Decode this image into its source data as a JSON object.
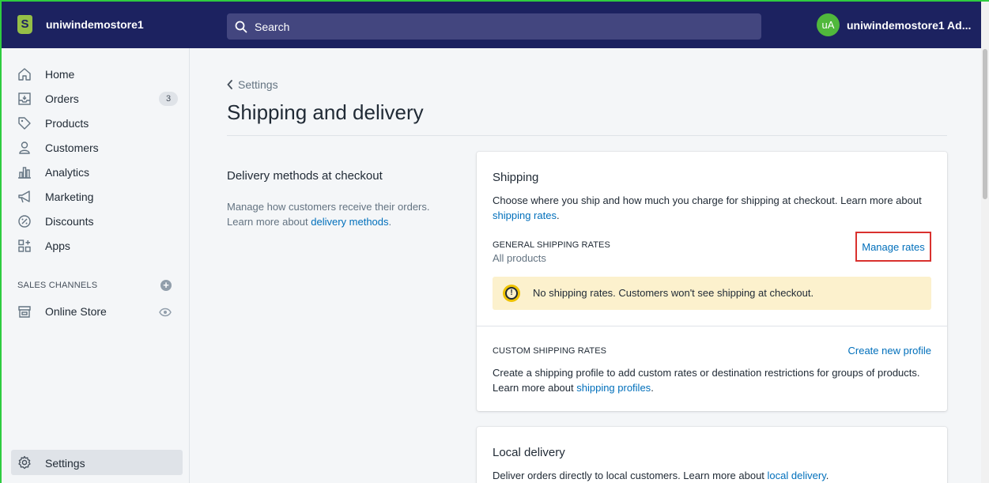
{
  "topbar": {
    "store_name": "uniwindemostore1",
    "logo_letter": "S",
    "search_placeholder": "Search",
    "avatar_initials": "uA",
    "account_name": "uniwindemostore1 Ad..."
  },
  "sidebar": {
    "items": [
      {
        "label": "Home",
        "icon": "home-icon"
      },
      {
        "label": "Orders",
        "icon": "orders-icon",
        "badge": "3"
      },
      {
        "label": "Products",
        "icon": "tag-icon"
      },
      {
        "label": "Customers",
        "icon": "person-icon"
      },
      {
        "label": "Analytics",
        "icon": "bar-chart-icon"
      },
      {
        "label": "Marketing",
        "icon": "megaphone-icon"
      },
      {
        "label": "Discounts",
        "icon": "discount-icon"
      },
      {
        "label": "Apps",
        "icon": "apps-icon"
      }
    ],
    "sales_channels_label": "SALES CHANNELS",
    "online_store_label": "Online Store",
    "settings_label": "Settings"
  },
  "main": {
    "back_label": "Settings",
    "page_title": "Shipping and delivery",
    "section_title": "Delivery methods at checkout",
    "section_desc": "Manage how customers receive their orders. Learn more about ",
    "section_link": "delivery methods",
    "section_end": ".",
    "shipping_card": {
      "title": "Shipping",
      "desc": "Choose where you ship and how much you charge for shipping at checkout. Learn more about ",
      "desc_link": "shipping rates",
      "desc_end": ".",
      "general_label": "GENERAL SHIPPING RATES",
      "general_sub": "All products",
      "manage_rates": "Manage rates",
      "warning": "No shipping rates. Customers won't see shipping at checkout.",
      "custom_label": "CUSTOM SHIPPING RATES",
      "create_profile": "Create new profile",
      "custom_desc": "Create a shipping profile to add custom rates or destination restrictions for groups of products. Learn more about ",
      "custom_link": "shipping profiles",
      "custom_end": "."
    },
    "local_card": {
      "title": "Local delivery",
      "desc": "Deliver orders directly to local customers. Learn more about ",
      "desc_link": "local delivery",
      "desc_end": "."
    }
  },
  "colors": {
    "topbar": "#1c2260",
    "accent_link": "#006fbb",
    "highlight_border": "#d9312e",
    "warning_bg": "#fcf1cd"
  }
}
